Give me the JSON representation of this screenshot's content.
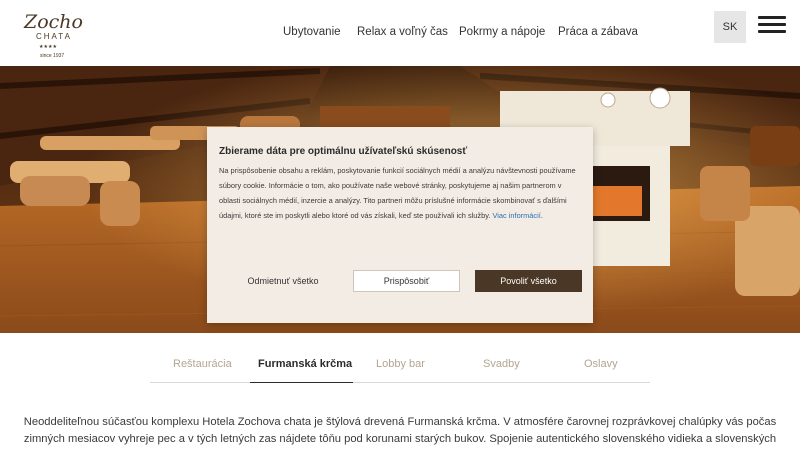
{
  "header": {
    "logo_alt": "Zochova chata since 1937",
    "nav": [
      "Ubytovanie",
      "Relax a voľný čas",
      "Pokrmy a nápoje",
      "Práca a zábava"
    ],
    "lang": "SK"
  },
  "cookie": {
    "title": "Zbierame dáta pre optimálnu užívateľskú skúsenosť",
    "text": "Na prispôsobenie obsahu a reklám, poskytovanie funkcií sociálnych médií a analýzu návštevnosti používame súbory cookie. Informácie o tom, ako používate naše webové stránky, poskytujeme aj našim partnerom v oblasti sociálnych médií, inzercie a analýzy. Tito partneri môžu príslušné informácie skombinovať s ďalšími údajmi, ktoré ste im poskytli alebo ktoré od vás získali, keď ste používali ich služby.",
    "more_link": "Viac informácií",
    "reject": "Odmietnuť všetko",
    "customize": "Prispôsobiť",
    "accept": "Povoliť všetko"
  },
  "tabs": [
    "Reštaurácia",
    "Furmanská krčma",
    "Lobby bar",
    "Svadby",
    "Oslavy"
  ],
  "content": {
    "paragraph": "Neoddeliteľnou súčasťou komplexu Hotela Zochova chata je štýlová drevená Furmanská krčma. V atmosfére čarovnej rozprávkovej chalúpky vás počas zimných mesiacov vyhreje pec a v tých letných zas nájdete tôňu pod korunami starých bukov. Spojenie autentického slovenského vidieka a slovenských špecialít vytvára miesto..."
  },
  "colors": {
    "accent": "#4a3725",
    "tab_inactive": "#b3a590",
    "dialog_bg": "#f3ece4",
    "link": "#2a6fb3"
  }
}
